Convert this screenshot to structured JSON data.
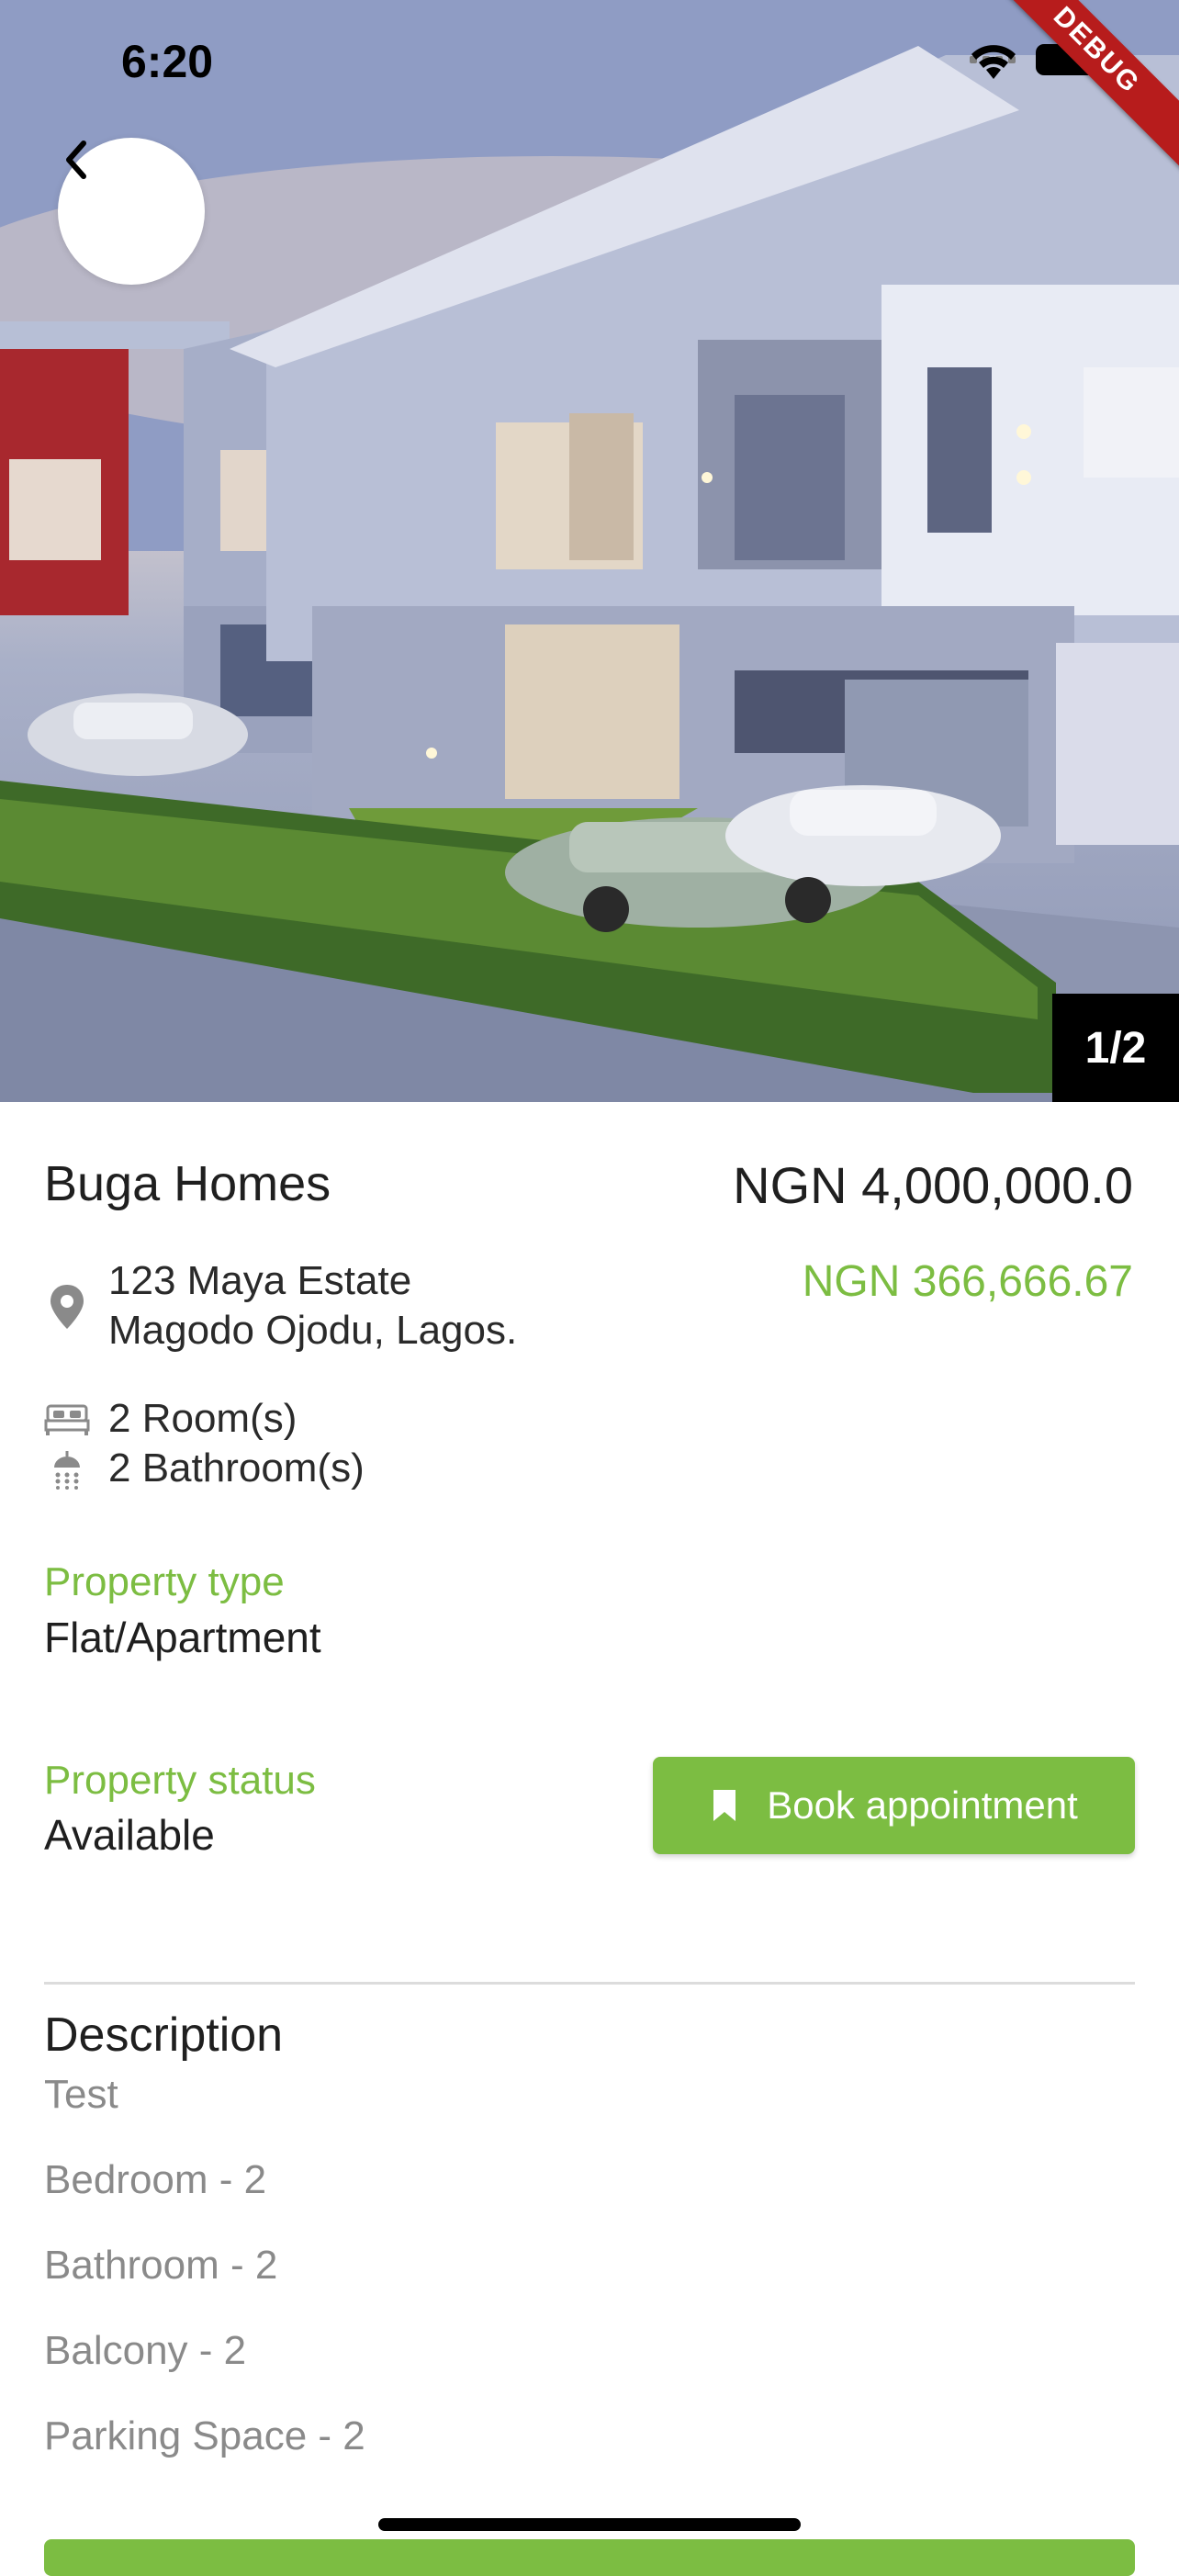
{
  "status_bar": {
    "time": "6:20",
    "debug_label": "DEBUG"
  },
  "gallery": {
    "counter": "1/2"
  },
  "property": {
    "name": "Buga Homes",
    "price": "NGN 4,000,000.0",
    "monthly_price": "NGN 366,666.67",
    "address_line1": "123 Maya Estate",
    "address_line2": "Magodo Ojodu, Lagos.",
    "rooms": "2 Room(s)",
    "bathrooms": "2 Bathroom(s)",
    "type_label": "Property type",
    "type_value": "Flat/Apartment",
    "status_label": "Property status",
    "status_value": "Available"
  },
  "actions": {
    "book_label": "Book appointment"
  },
  "description": {
    "title": "Description",
    "lines": [
      "Test",
      "Bedroom - 2",
      "Bathroom - 2",
      "Balcony - 2",
      "Parking Space - 2"
    ]
  },
  "colors": {
    "accent": "#7cbd42",
    "debug": "#b71c1c"
  }
}
